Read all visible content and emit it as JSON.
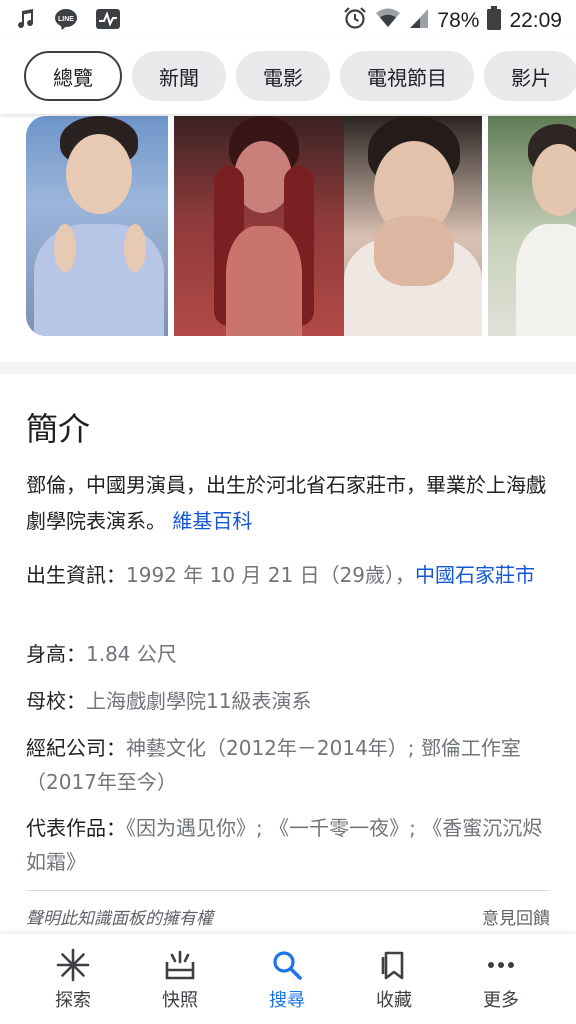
{
  "status_bar": {
    "battery": "78%",
    "time": "22:09",
    "left_icons": [
      "music-note-icon",
      "line-icon",
      "activity-icon"
    ],
    "right_icons": [
      "alarm-icon",
      "wifi-icon",
      "signal-icon",
      "battery-icon"
    ]
  },
  "chips": [
    "總覽",
    "新聞",
    "電影",
    "電視節目",
    "影片"
  ],
  "about": {
    "title": "簡介",
    "description": "鄧倫，中國男演員，出生於河北省石家莊市，畢業於上海戲劇學院表演系。",
    "source_link": "維基百科"
  },
  "facts": {
    "birth": {
      "label": "出生資訊：",
      "value": "1992 年 10 月 21 日（29歲），",
      "link": "中國石家莊市"
    },
    "height": {
      "label": "身高：",
      "value": "1.84 公尺"
    },
    "school": {
      "label": "母校：",
      "value": "上海戲劇學院11級表演系"
    },
    "agency": {
      "label": "經紀公司：",
      "value": "神藝文化（2012年－2014年）; 鄧倫工作室（2017年至今）"
    },
    "works": {
      "label": "代表作品：",
      "value": "《因为遇见你》; 《一千零一夜》; 《香蜜沉沉烬如霜》"
    }
  },
  "footer": {
    "claim": "聲明此知識面板的擁有權",
    "feedback": "意見回饋"
  },
  "bottom_nav": [
    {
      "label": "探索",
      "icon": "asterisk-icon"
    },
    {
      "label": "快照",
      "icon": "snapshot-icon"
    },
    {
      "label": "搜尋",
      "icon": "search-icon"
    },
    {
      "label": "收藏",
      "icon": "bookmark-icon"
    },
    {
      "label": "更多",
      "icon": "more-dots-icon"
    }
  ],
  "colors": {
    "link": "#1558d6",
    "active_nav": "#1a73e8"
  }
}
